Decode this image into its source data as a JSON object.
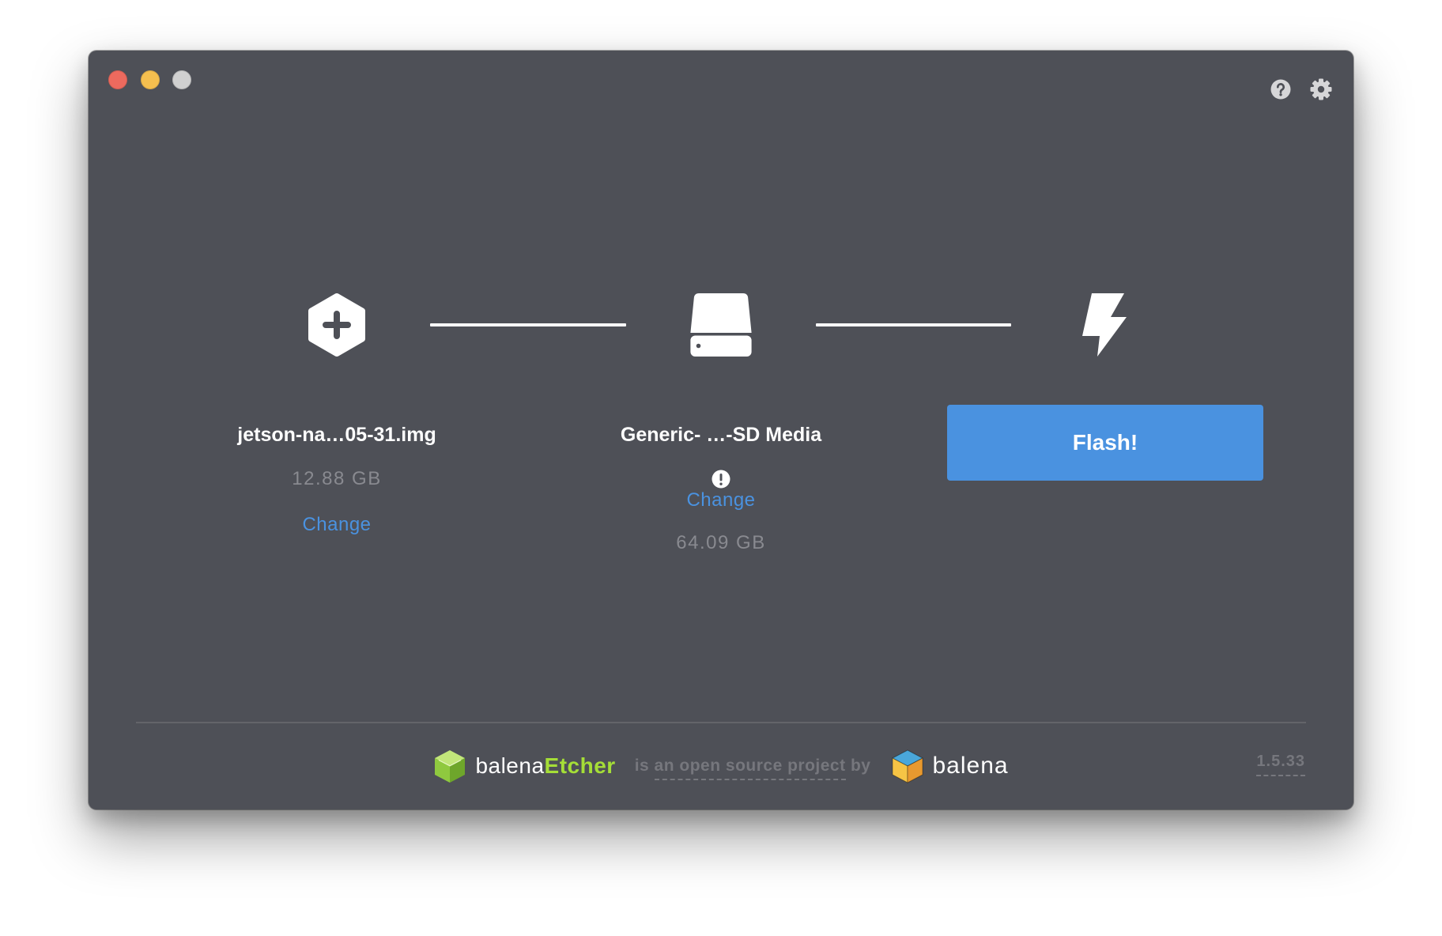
{
  "window": {
    "traffic_light_colors": {
      "close": "#ed6a5e",
      "minimize": "#f5bf4f",
      "zoom": "#d0d0d0"
    }
  },
  "toolbar": {
    "help_icon": "help-icon",
    "settings_icon": "settings-icon"
  },
  "steps": [
    {
      "icon": "plus-hexagon-icon",
      "title": "jetson-na…05-31.img",
      "size": "12.88 GB",
      "change_label": "Change"
    },
    {
      "icon": "drive-icon",
      "title": "Generic- …-SD Media",
      "status_icon": "warning-icon",
      "change_label": "Change",
      "size": "64.09 GB"
    },
    {
      "icon": "flash-icon",
      "button_label": "Flash!"
    }
  ],
  "footer": {
    "brand": {
      "logo_icon": "etcher-cube-icon",
      "prefix": "balena",
      "suffix": "Etcher"
    },
    "text_before": "is",
    "link_text": "an open source project",
    "text_after": "by",
    "company": {
      "logo_icon": "balena-cube-icon",
      "name": "balena"
    },
    "version": "1.5.33"
  },
  "colors": {
    "window_background": "#4e5057",
    "accent_blue": "#4a92e0",
    "etcher_green": "#a5de37",
    "muted_text": "#898a90",
    "footer_text": "#76777d"
  }
}
